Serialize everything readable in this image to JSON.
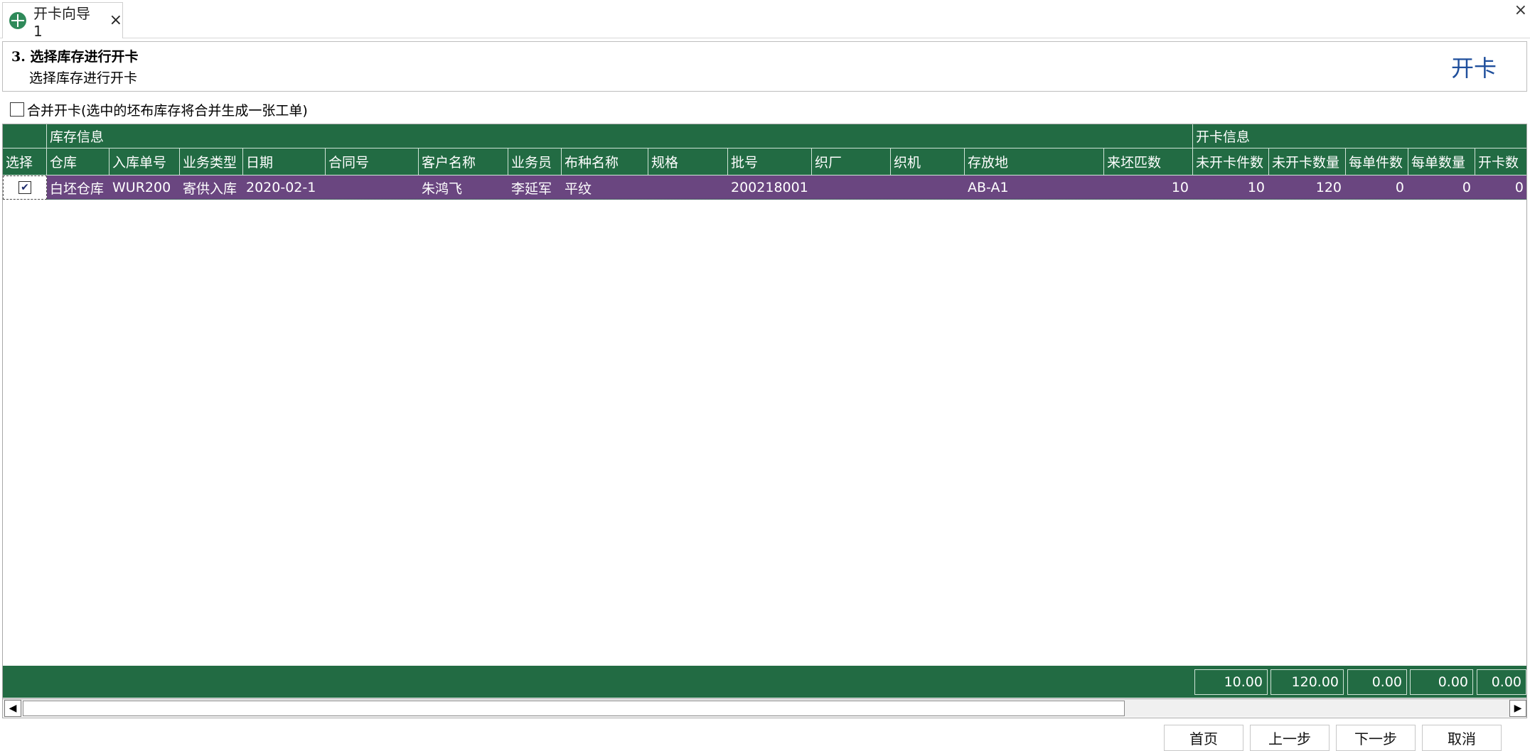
{
  "tab": {
    "label": "开卡向导1",
    "close": "×",
    "window_close": "×"
  },
  "step": {
    "title": "3.  选择库存进行开卡",
    "subtitle": "选择库存进行开卡",
    "right_label": "开卡"
  },
  "merge": {
    "label": "合并开卡(选中的坯布库存将合并生成一张工单)",
    "checked": false
  },
  "grid": {
    "group_headers": [
      "库存信息",
      "开卡信息"
    ],
    "select_header": "选择",
    "columns": [
      "仓库",
      "入库单号",
      "业务类型",
      "日期",
      "合同号",
      "客户名称",
      "业务员",
      "布种名称",
      "规格",
      "批号",
      "织厂",
      "织机",
      "存放地",
      "来坯匹数",
      "未开卡件数",
      "未开卡数量",
      "每单件数",
      "每单数量",
      "开卡数"
    ],
    "rows": [
      {
        "checked": true,
        "check_mark": "✔",
        "cells": [
          "白坯仓库",
          "WUR200",
          "寄供入库",
          "2020-02-1",
          "",
          "朱鸿飞",
          "李延军",
          "平纹",
          "",
          "200218001",
          "",
          "",
          "AB-A1",
          "10",
          "10",
          "120",
          "0",
          "0",
          "0"
        ]
      }
    ],
    "footer_totals": [
      "10.00",
      "120.00",
      "0.00",
      "0.00",
      "0.00"
    ]
  },
  "scrollbar": {
    "left_arrow": "◀",
    "right_arrow": "▶"
  },
  "buttons": {
    "first": "首页",
    "prev": "上一步",
    "next": "下一步",
    "cancel": "取消"
  }
}
